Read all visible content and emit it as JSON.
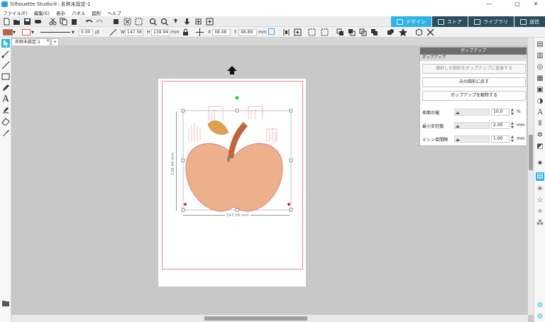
{
  "window": {
    "title": "Silhouette Studio®: 名称未設定-1",
    "minimize": "—",
    "maximize": "□",
    "close": "✕"
  },
  "menu": [
    "ファイル(F)",
    "編集(E)",
    "表示",
    "パネル",
    "図形",
    "ヘルプ"
  ],
  "tabs": [
    {
      "label": "デザイン",
      "active": true
    },
    {
      "label": "ストア",
      "active": false
    },
    {
      "label": "ライブラリ",
      "active": false
    },
    {
      "label": "送信",
      "active": false
    }
  ],
  "toolbar2": {
    "line_width": "0.00",
    "line_unit": "pt",
    "w_label": "W",
    "w_value": "147.56",
    "h_label": "H",
    "h_value": "139.94",
    "size_unit": "mm",
    "x_label": "X",
    "x_value": "38.48",
    "y_label": "Y",
    "y_value": "48.89",
    "pos_unit": "mm"
  },
  "colors": {
    "fill": "#c0603d",
    "accent": "#2fb3e6",
    "apple": "#edb08c",
    "stem": "#c0663c",
    "leaf": "#e0a050"
  },
  "doc_tab": {
    "label": "名称未設定-1",
    "close": "×",
    "add": "+"
  },
  "canvas": {
    "width_dim": "147.56 mm",
    "height_dim": "139.94 mm"
  },
  "panel": {
    "header": "ポップアップ",
    "section": "ポップアップ",
    "convert_button": "選択した図形をポップアップに変換する",
    "restore_button": "元の図形に戻す",
    "release_button": "ポップアップを解除する",
    "rows": [
      {
        "label": "差面の幅",
        "value": "10.0",
        "unit": "%"
      },
      {
        "label": "最小支柱幅",
        "value": "2.00",
        "unit": "mm"
      },
      {
        "label": "ミシン目間隔",
        "value": "1.00",
        "unit": "mm"
      }
    ]
  }
}
